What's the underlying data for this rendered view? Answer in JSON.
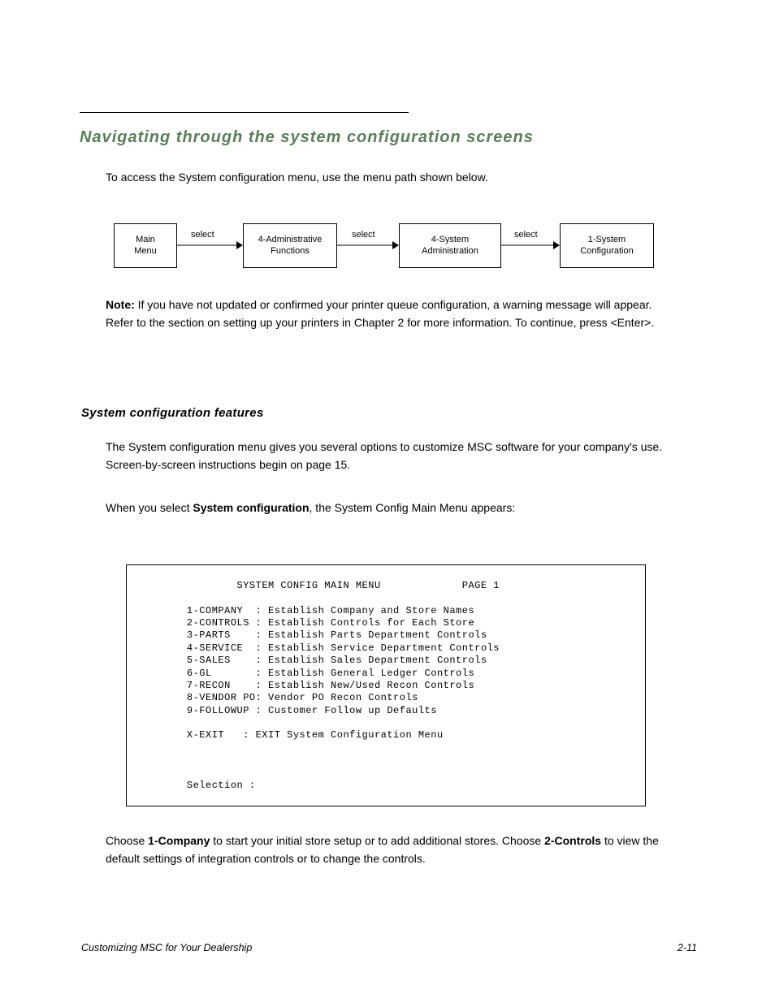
{
  "section_heading": "Navigating through the system configuration screens",
  "intro_text": "To access the System configuration menu, use the menu path shown below.",
  "flow": {
    "box1": [
      "Main",
      "Menu"
    ],
    "box2": [
      "4-Administrative",
      "Functions"
    ],
    "box3": [
      "4-System",
      "Administration"
    ],
    "box4": [
      "1-System",
      "Configuration"
    ],
    "arrow1_label": "select",
    "arrow2_label": "select",
    "arrow3_label": "select"
  },
  "note_paragraph": {
    "prefix_bold": "Note:",
    "rest": " If you have not updated or confirmed your printer queue configuration, a warning message will appear. Refer to the section on setting up your printers in Chapter 2 for more information. To continue, press <Enter>."
  },
  "subheading": "System configuration features",
  "sc_p1": "The System configuration menu gives you several options to customize MSC software for your company's use. Screen-by-screen instructions begin on page 15.",
  "sc_p2_prefix": "When you select",
  "sc_p2_bold": " System configuration",
  "sc_p2_suffix": ", the System Config Main Menu appears:",
  "code": "               SYSTEM CONFIG MAIN MENU             PAGE 1\n\n       1-COMPANY  : Establish Company and Store Names\n       2-CONTROLS : Establish Controls for Each Store\n       3-PARTS    : Establish Parts Department Controls\n       4-SERVICE  : Establish Service Department Controls\n       5-SALES    : Establish Sales Department Controls\n       6-GL       : Establish General Ledger Controls\n       7-RECON    : Establish New/Used Recon Controls\n       8-VENDOR PO: Vendor PO Recon Controls\n       9-FOLLOWUP : Customer Follow up Defaults\n\n       X-EXIT   : EXIT System Configuration Menu\n\n\n\n       Selection :",
  "after_code_paragraph": {
    "prefix": "Choose ",
    "bold1": "1-Company",
    "mid": " to start your initial store setup or to add additional stores. Choose ",
    "bold2": "2-Controls",
    "suffix": " to view the default settings of integration controls or to change the controls."
  },
  "footer_left": "Customizing MSC for Your Dealership",
  "footer_right": "2-11"
}
